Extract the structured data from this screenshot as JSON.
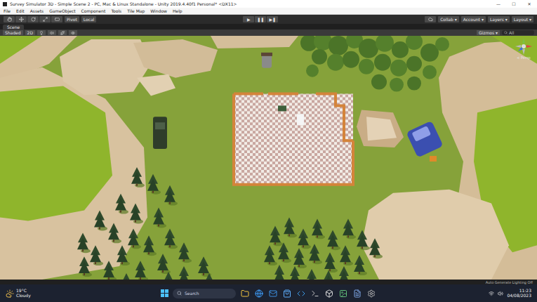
{
  "window": {
    "title": "Survey Simulator 3D - Simple Scene 2 - PC, Mac & Linux Standalone - Unity 2019.4.40f1 Personal* <DX11>",
    "controls": [
      "—",
      "☐",
      "✕"
    ]
  },
  "menu": [
    "File",
    "Edit",
    "Assets",
    "GameObject",
    "Component",
    "Tools",
    "Tile Map",
    "Window",
    "Help"
  ],
  "toolbar": {
    "pivot": "Pivot",
    "space": "Local",
    "play": [
      "▶",
      "❚❚",
      "▶❚"
    ],
    "right": [
      "Collab ▾",
      "Account ▾",
      "Layers ▾",
      "Layout ▾"
    ]
  },
  "scene_tab": {
    "label": "Scene",
    "selected": true
  },
  "scene_toolbar": {
    "shading": "Shaded",
    "mode": "2D",
    "gizmos": "Gizmos ▾",
    "search": "All"
  },
  "gizmo": {
    "label": "< Persp"
  },
  "status_bar": {
    "text": "Auto Generate Lighting Off"
  },
  "taskbar": {
    "weather_temp": "19°C",
    "weather_text": "Cloudy",
    "search_placeholder": "Search",
    "time": "11:23",
    "date": "04/08/2023"
  }
}
